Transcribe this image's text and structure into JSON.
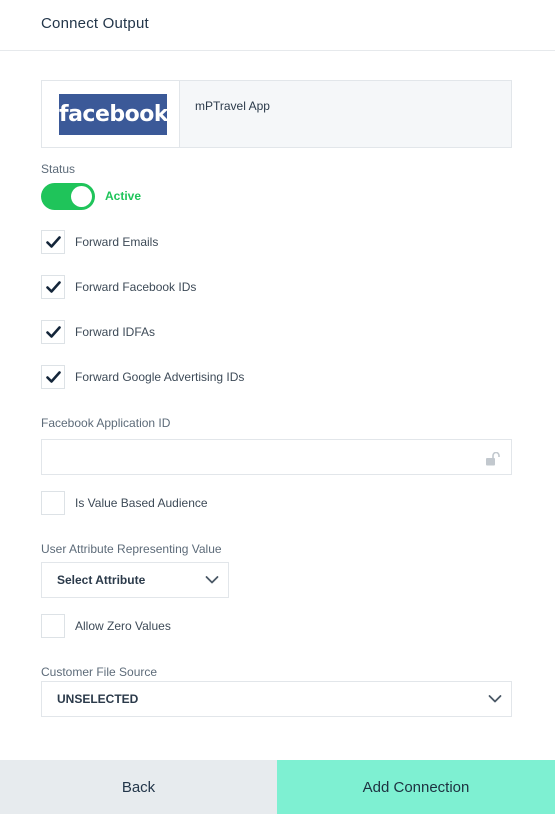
{
  "header": {
    "title": "Connect Output"
  },
  "partner": {
    "logo_text": "facebook",
    "name": "mPTravel App",
    "logo_color": "#3b5998"
  },
  "status": {
    "label": "Status",
    "value_text": "Active",
    "enabled": true,
    "accent": "#1fc45a"
  },
  "options": [
    {
      "label": "Forward Emails",
      "checked": true
    },
    {
      "label": "Forward Facebook IDs",
      "checked": true
    },
    {
      "label": "Forward IDFAs",
      "checked": true
    },
    {
      "label": "Forward Google Advertising IDs",
      "checked": true
    }
  ],
  "app_id": {
    "label": "Facebook Application ID",
    "value": "",
    "icon": "unlock-icon"
  },
  "value_based": {
    "label": "Is Value Based Audience",
    "checked": false
  },
  "user_attribute": {
    "label": "User Attribute Representing Value",
    "selected": "Select Attribute"
  },
  "allow_zero": {
    "label": "Allow Zero Values",
    "checked": false
  },
  "customer_file": {
    "label": "Customer File Source",
    "selected": "UNSELECTED"
  },
  "footer": {
    "back_label": "Back",
    "add_label": "Add Connection",
    "add_color": "#7ef0d2"
  }
}
